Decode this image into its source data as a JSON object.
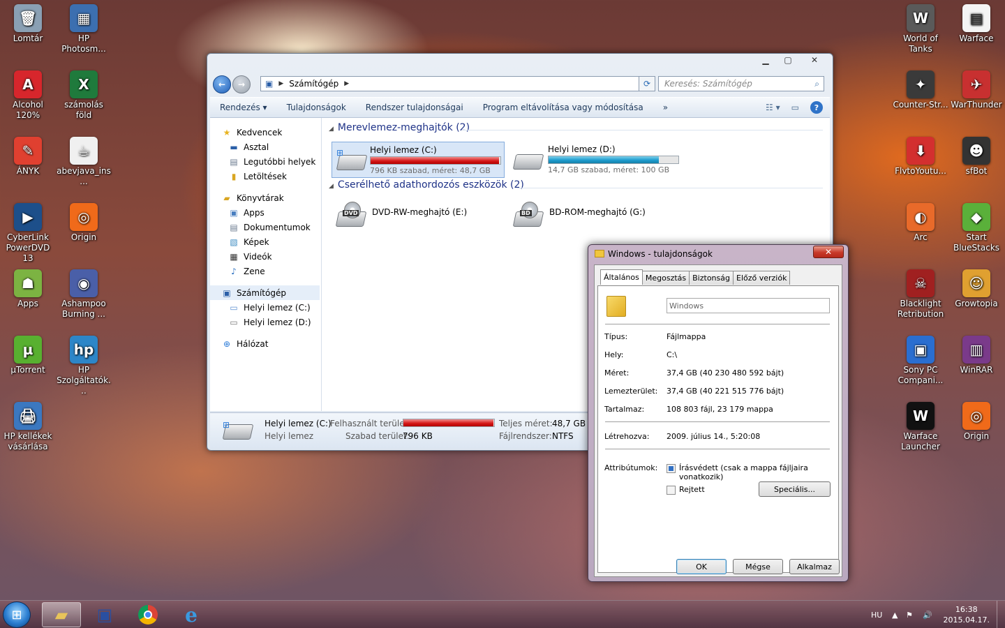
{
  "desktop_icons_left": [
    {
      "label": "Lomtár",
      "icon": "recycle-bin-icon",
      "color": "#8aa0b4",
      "glyph": "🗑"
    },
    {
      "label": "HP Photosm...",
      "icon": "hp-photosmart-icon",
      "color": "#3c6fb0",
      "glyph": "▦"
    },
    {
      "label": "Alcohol 120%",
      "icon": "alcohol-120-icon",
      "color": "#d7262c",
      "glyph": "A"
    },
    {
      "label": "számolás föld",
      "icon": "excel-file-icon",
      "color": "#1f7a3c",
      "glyph": "X"
    },
    {
      "label": "ÁNYK",
      "icon": "anyk-icon",
      "color": "#e04030",
      "glyph": "✎"
    },
    {
      "label": "abevjava_ins...",
      "icon": "java-installer-icon",
      "color": "#f0f0f0",
      "glyph": "☕"
    },
    {
      "label": "CyberLink PowerDVD 13",
      "icon": "powerdvd-icon",
      "color": "#1d4f8a",
      "glyph": "▶"
    },
    {
      "label": "Origin",
      "icon": "origin-icon",
      "color": "#f06a1a",
      "glyph": "◎"
    },
    {
      "label": "Apps",
      "icon": "android-apps-icon",
      "color": "#7cb342",
      "glyph": "☗"
    },
    {
      "label": "Ashampoo Burning ...",
      "icon": "ashampoo-icon",
      "color": "#4a5fa8",
      "glyph": "◉"
    },
    {
      "label": "µTorrent",
      "icon": "utorrent-icon",
      "color": "#58b030",
      "glyph": "µ"
    },
    {
      "label": "HP Szolgáltatók...",
      "icon": "hp-services-icon",
      "color": "#2d86c8",
      "glyph": "hp"
    },
    {
      "label": "HP kellékek vásárlása",
      "icon": "hp-supplies-icon",
      "color": "#3b78c0",
      "glyph": "🖨"
    }
  ],
  "desktop_icons_right": [
    {
      "label": "World of Tanks",
      "icon": "world-of-tanks-icon",
      "color": "#5a5a5a",
      "glyph": "W"
    },
    {
      "label": "Warface",
      "icon": "warface-icon",
      "color": "#f4f4f4",
      "glyph": "▤"
    },
    {
      "label": "Counter-Str...",
      "icon": "counter-strike-icon",
      "color": "#3a3a3a",
      "glyph": "✦"
    },
    {
      "label": "WarThunder",
      "icon": "warthunder-icon",
      "color": "#c83030",
      "glyph": "✈"
    },
    {
      "label": "FlvtoYoutu...",
      "icon": "flvto-icon",
      "color": "#d32f2f",
      "glyph": "⬇"
    },
    {
      "label": "sfBot",
      "icon": "sfbot-icon",
      "color": "#333333",
      "glyph": "☻"
    },
    {
      "label": "Arc",
      "icon": "arc-icon",
      "color": "#e86a2a",
      "glyph": "◐"
    },
    {
      "label": "Start BlueStacks",
      "icon": "bluestacks-icon",
      "color": "#5ab03a",
      "glyph": "◆"
    },
    {
      "label": "Blacklight Retribution",
      "icon": "blacklight-icon",
      "color": "#a02020",
      "glyph": "☠"
    },
    {
      "label": "Growtopia",
      "icon": "growtopia-icon",
      "color": "#e0a030",
      "glyph": "☺"
    },
    {
      "label": "Sony PC Compani...",
      "icon": "sony-pc-companion-icon",
      "color": "#2a6ed0",
      "glyph": "▣"
    },
    {
      "label": "WinRAR",
      "icon": "winrar-icon",
      "color": "#7a3a8a",
      "glyph": "▥"
    },
    {
      "label": "Warface Launcher",
      "icon": "warface-launcher-icon",
      "color": "#111111",
      "glyph": "W"
    },
    {
      "label": "Origin",
      "icon": "origin-icon",
      "color": "#f06a1a",
      "glyph": "◎"
    }
  ],
  "explorer": {
    "address_crumb": "Számítógép",
    "search_placeholder": "Keresés: Számítógép",
    "toolbar": {
      "organize": "Rendezés",
      "properties": "Tulajdonságok",
      "system_properties": "Rendszer tulajdonságai",
      "uninstall": "Program eltávolítása vagy módosítása",
      "more": "»"
    },
    "nav": {
      "favorites": "Kedvencek",
      "desktop": "Asztal",
      "recent": "Legutóbbi helyek",
      "downloads": "Letöltések",
      "libraries": "Könyvtárak",
      "apps": "Apps",
      "documents": "Dokumentumok",
      "pictures": "Képek",
      "videos": "Videók",
      "music": "Zene",
      "computer": "Számítógép",
      "drive_c": "Helyi lemez (C:)",
      "drive_d": "Helyi lemez (D:)",
      "network": "Hálózat"
    },
    "groups": {
      "hdd_title": "Merevlemez-meghajtók (2)",
      "removable_title": "Cserélhető adathordozós eszközök (2)"
    },
    "drives": [
      {
        "name": "Helyi lemez (C:)",
        "sub": "796 KB szabad, méret: 48,7 GB",
        "used_fraction": 0.99,
        "bar_color": "red"
      },
      {
        "name": "Helyi lemez (D:)",
        "sub": "14,7 GB szabad, méret: 100 GB",
        "used_fraction": 0.85,
        "bar_color": "blue"
      }
    ],
    "removable": [
      {
        "name": "DVD-RW-meghajtó (E:)",
        "badge": "DVD"
      },
      {
        "name": "BD-ROM-meghajtó (G:)",
        "badge": "BD"
      }
    ],
    "details": {
      "name": "Helyi lemez (C:)",
      "type": "Helyi lemez",
      "used_label": "Felhasznált terület:",
      "used_fraction": 0.99,
      "free_label": "Szabad terület:",
      "free_value": "796 KB",
      "total_label": "Teljes méret:",
      "total_value": "48,7 GB",
      "fs_label": "Fájlrendszer:",
      "fs_value": "NTFS"
    }
  },
  "dialog": {
    "title": "Windows - tulajdonságok",
    "tabs": [
      "Általános",
      "Megosztás",
      "Biztonság",
      "Előző verziók"
    ],
    "name_value": "Windows",
    "props": [
      {
        "label": "Típus:",
        "value": "Fájlmappa"
      },
      {
        "label": "Hely:",
        "value": "C:\\"
      },
      {
        "label": "Méret:",
        "value": "37,4 GB (40 230 480 592 bájt)"
      },
      {
        "label": "Lemezterület:",
        "value": "37,4 GB (40 221 515 776 bájt)"
      },
      {
        "label": "Tartalmaz:",
        "value": "108 803 fájl, 23 179 mappa"
      }
    ],
    "created_label": "Létrehozva:",
    "created_value": "2009. július 14., 5:20:08",
    "attributes_label": "Attribútumok:",
    "readonly_label": "Írásvédett (csak a mappa fájljaira vonatkozik)",
    "hidden_label": "Rejtett",
    "advanced_btn": "Speciális...",
    "ok": "OK",
    "cancel": "Mégse",
    "apply": "Alkalmaz"
  },
  "taskbar": {
    "language": "HU",
    "time": "16:38",
    "date": "2015.04.17."
  }
}
